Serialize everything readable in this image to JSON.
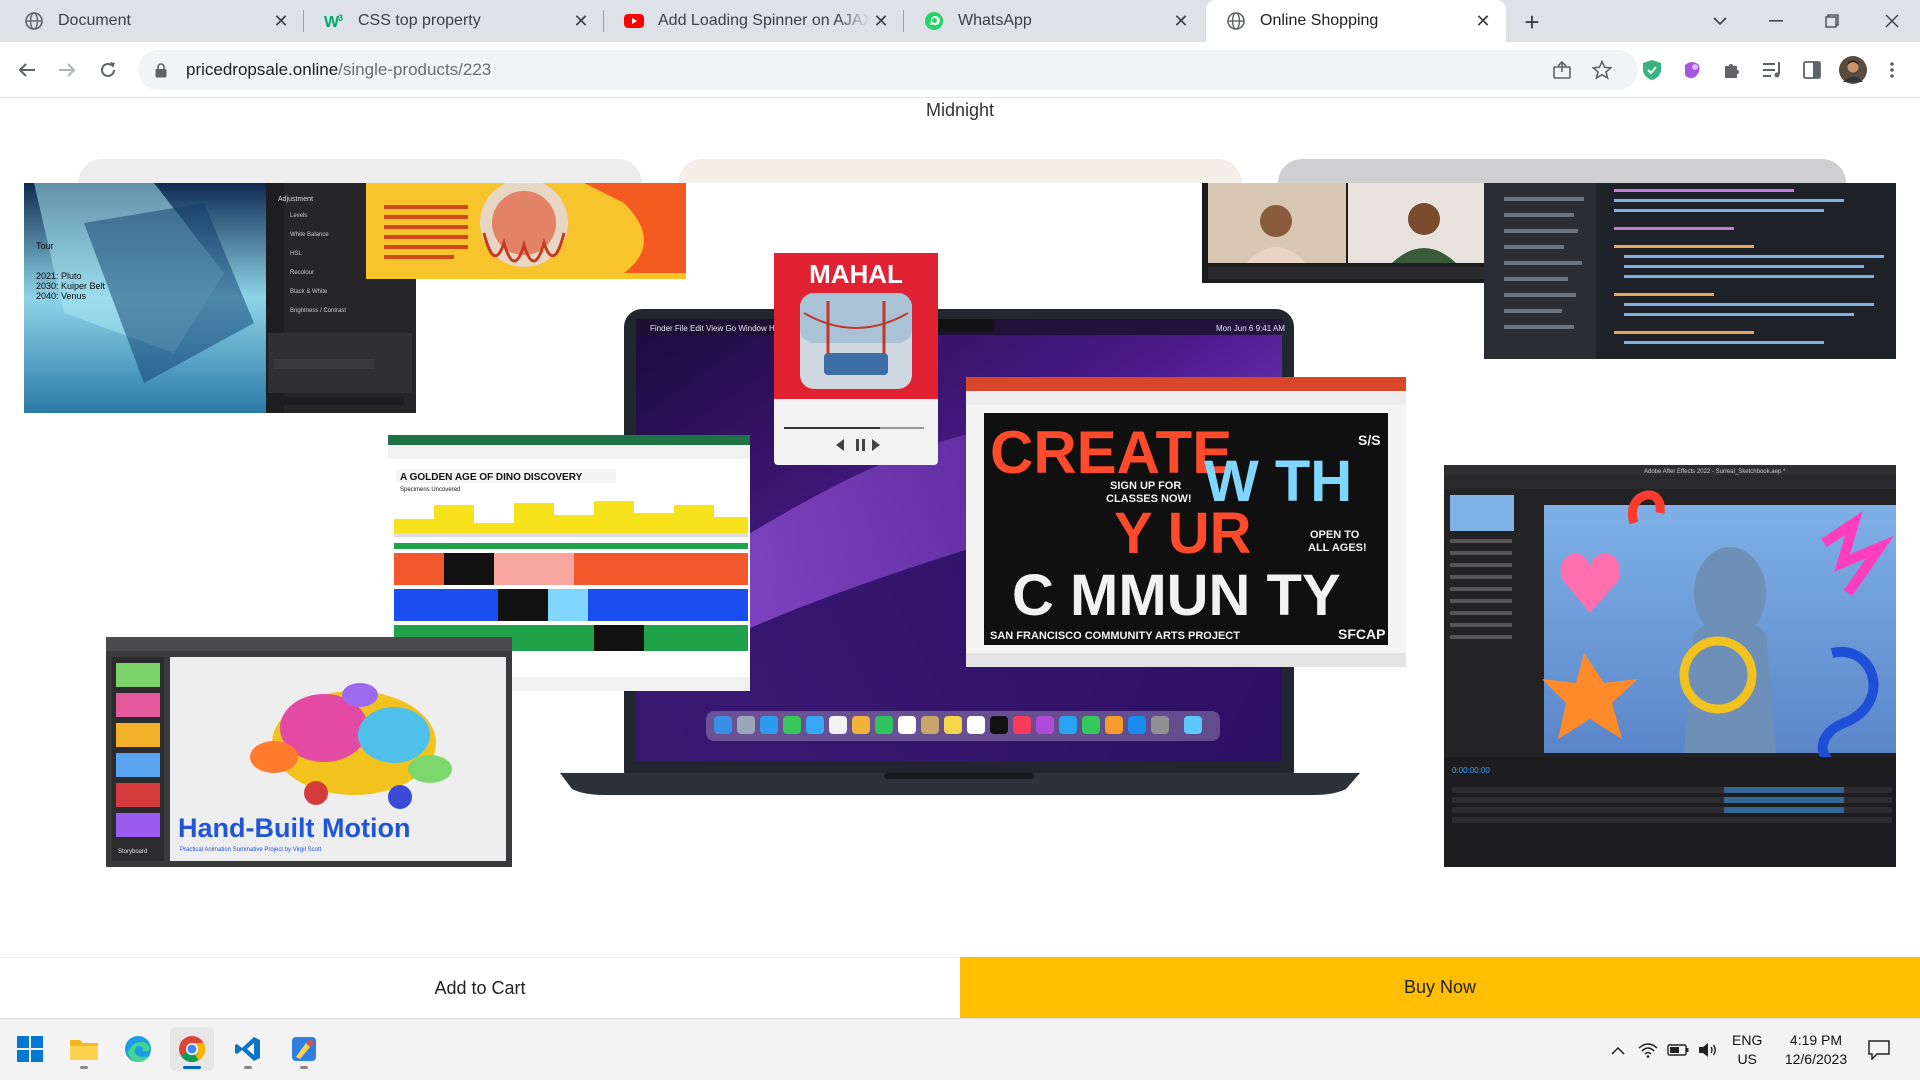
{
  "browser": {
    "tabs": [
      {
        "title": "Document",
        "icon": "globe-icon",
        "active": false
      },
      {
        "title": "CSS top property",
        "icon": "w3schools-icon",
        "active": false
      },
      {
        "title": "Add Loading Spinner on AJAX ca",
        "icon": "youtube-icon",
        "active": false
      },
      {
        "title": "WhatsApp",
        "icon": "whatsapp-icon",
        "active": false
      },
      {
        "title": "Online Shopping",
        "icon": "globe-icon",
        "active": true
      }
    ],
    "url_host": "pricedropsale.online",
    "url_path": "/single-products/223"
  },
  "page": {
    "variant_label": "Midnight",
    "add_to_cart_label": "Add to Cart",
    "buy_now_label": "Buy Now",
    "hero_texts": {
      "tour": "Tour",
      "pluto": "2021: Pluto",
      "kuiper": "2030: Kuiper Belt",
      "venus": "2040: Venus",
      "mahal": "MAHAL",
      "create": "CREATE",
      "with": "W TH",
      "your": "Y UR",
      "community": "C MMUN TY",
      "sign_up": "SIGN UP FOR",
      "classes": "CLASSES NOW!",
      "open_to": "OPEN TO",
      "all_ages": "ALL AGES!",
      "ss": "S/S",
      "sfcap_project": "SAN FRANCISCO COMMUNITY ARTS PROJECT",
      "sfcap": "SFCAP",
      "dino_title": "A GOLDEN AGE OF DINO DISCOVERY",
      "dino_sub": "Specimens Uncovered",
      "hand_built": "Hand-Built Motion",
      "hand_built_sub": "Practical Animation Summative Project by Virgil Scott",
      "adjustment": "Adjustment",
      "levels": "Levels",
      "white_balance": "White Balance",
      "hsl": "HSL",
      "recolor": "Recolour",
      "black_white": "Black & White",
      "brightness": "Brightness / Contrast",
      "finder_menu": "Finder   File   Edit   View   Go   Window   Help",
      "menu_clock": "Mon Jun 6  9:41 AM",
      "after_effects": "Adobe After Effects 2022 - Surreal_Sketchbook.aep *",
      "ae_time": "0:00:00:00",
      "storyboard": "Storyboard"
    }
  },
  "taskbar": {
    "lang_top": "ENG",
    "lang_bottom": "US",
    "time": "4:19 PM",
    "date": "12/6/2023"
  },
  "colors": {
    "buy_now": "#ffbf00",
    "tab_strip": "#dee1e6",
    "omnibox": "#f1f3f4"
  }
}
